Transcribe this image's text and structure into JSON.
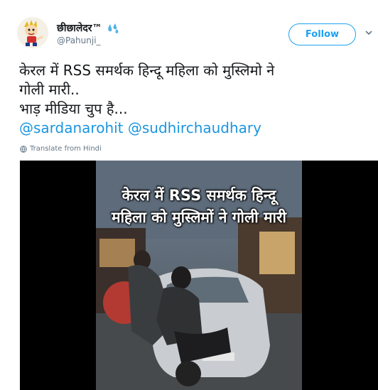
{
  "user": {
    "display_name": "छीछालेदर™",
    "handle": "@Pahunji_"
  },
  "follow_label": "Follow",
  "tweet": {
    "lines": [
      "केरल में RSS समर्थक हिन्दू महिला को मुस्लिमो ने",
      "गोली मारी..",
      "भाड़ मीडिया चुप है..."
    ],
    "mentions": [
      "@sardanarohit",
      "@sudhirchaudhary"
    ]
  },
  "translate_label": "Translate from Hindi",
  "video": {
    "caption_lines": [
      "केरल में RSS समर्थक हिन्दू",
      "महिला को मुस्लिमों ने गोली मारी"
    ]
  },
  "colors": {
    "accent": "#1da1f2",
    "mention": "#1b95e0",
    "secondary_text": "#657786"
  },
  "icons": {
    "avatar": "cartoon-character-avatar",
    "badge": "sweat-droplets-emoji",
    "more": "chevron-down-icon",
    "translate": "globe-icon"
  }
}
